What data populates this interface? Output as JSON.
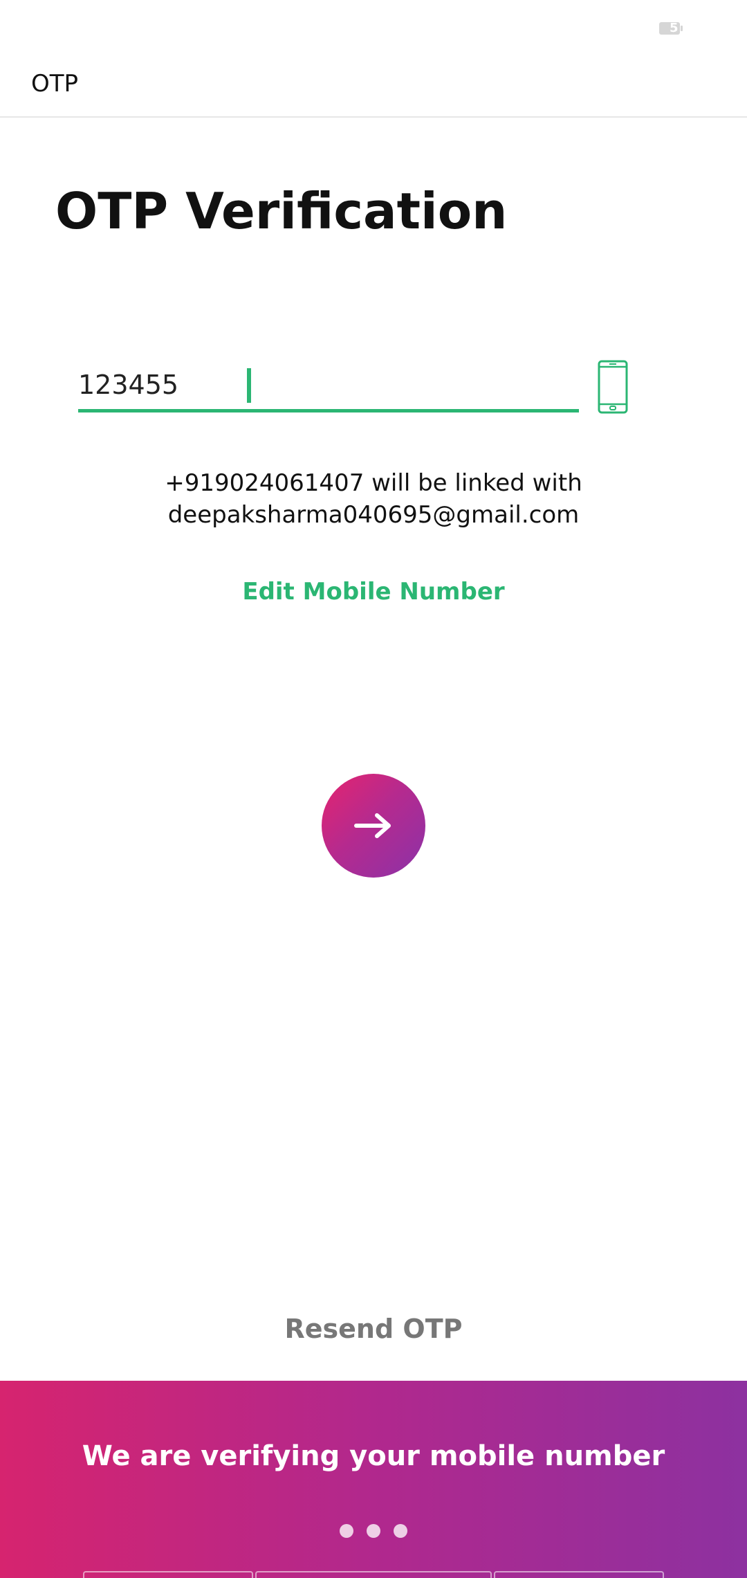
{
  "status_bar": {
    "battery_level": "5",
    "battery_icon": "battery-icon"
  },
  "app_bar": {
    "title": "OTP"
  },
  "page": {
    "heading": "OTP Verification"
  },
  "otp_input": {
    "value": "123455",
    "icon": "phone-icon",
    "accent_color": "#2bb673"
  },
  "message": {
    "line1": "+919024061407 will be linked with",
    "line2": "deepaksharma040695@gmail.com"
  },
  "edit_mobile": {
    "label": "Edit Mobile Number"
  },
  "submit": {
    "icon": "arrow-right-icon"
  },
  "resend": {
    "label": "Resend OTP"
  },
  "banner": {
    "text": "We are verifying your mobile number",
    "gradient_start": "#d6246f",
    "gradient_end": "#8d31a0",
    "progress_dots": 3
  }
}
